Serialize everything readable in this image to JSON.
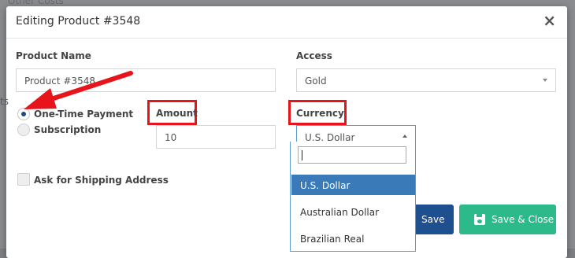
{
  "background": {
    "label": "Other Costs",
    "edge_label": "ts"
  },
  "modal": {
    "title": "Editing Product #3548",
    "close_label": "×"
  },
  "form": {
    "product_name_label": "Product Name",
    "product_name_value": "Product #3548",
    "access_label": "Access",
    "access_value": "Gold",
    "payment_options": [
      "One-Time Payment",
      "Subscription"
    ],
    "payment_selected": "One-Time Payment",
    "amount_label": "Amount",
    "amount_value": "10",
    "currency_label": "Currency",
    "currency_value": "U.S. Dollar",
    "shipping_label": "Ask for Shipping Address",
    "shipping_checked": false
  },
  "currency_dropdown": {
    "search_value": "",
    "options": [
      "U.S. Dollar",
      "Australian Dollar",
      "Brazilian Real"
    ],
    "highlighted": "U.S. Dollar"
  },
  "buttons": {
    "save": "Save",
    "save_close": "Save & Close"
  },
  "colors": {
    "annotation_red": "#e8141c",
    "primary_blue": "#1e4f8f",
    "success_green": "#2dba8a",
    "dropdown_highlight": "#3a7ab8"
  }
}
